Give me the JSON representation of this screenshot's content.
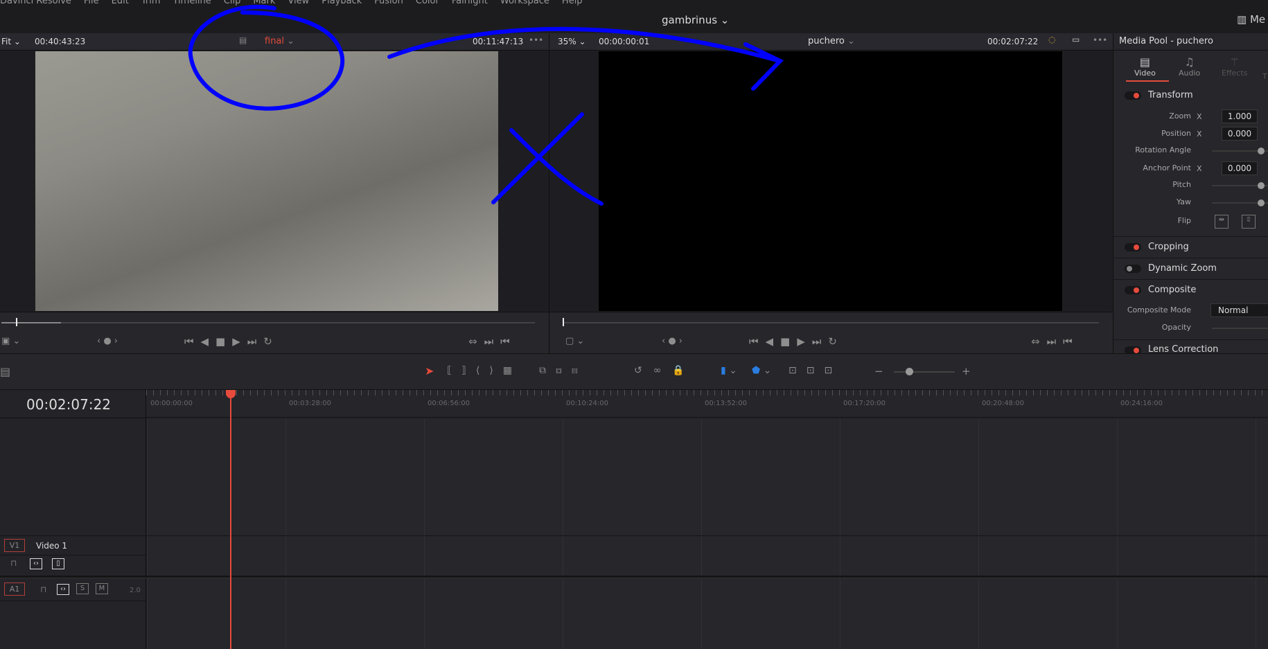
{
  "menu": [
    "Davinci Resolve",
    "File",
    "Edit",
    "Trim",
    "Timeline",
    "Clip",
    "Mark",
    "View",
    "Playback",
    "Fusion",
    "Color",
    "Fairlight",
    "Workspace",
    "Help"
  ],
  "project": "gambrinus ⌄",
  "top_right": "Me",
  "source": {
    "zoom": "Fit",
    "timecode": "00:40:43:23",
    "clip": "final",
    "duration": "00:11:47:13"
  },
  "timeline_viewer": {
    "zoom": "35%",
    "timecode": "00:00:00:01",
    "name": "puchero",
    "duration": "00:02:07:22"
  },
  "inspector": {
    "title": "Media Pool - puchero",
    "tabs": [
      "Video",
      "Audio",
      "Effects",
      "T"
    ],
    "active_tab": "Video",
    "transform": "Transform",
    "zoom_label": "Zoom",
    "zoom_x": "1.000",
    "position_label": "Position",
    "position_x": "0.000",
    "rotation_label": "Rotation Angle",
    "anchor_label": "Anchor Point",
    "anchor_x": "0.000",
    "pitch_label": "Pitch",
    "yaw_label": "Yaw",
    "flip_label": "Flip",
    "x": "X",
    "cropping": "Cropping",
    "dynamic_zoom": "Dynamic Zoom",
    "composite": "Composite",
    "composite_mode_label": "Composite Mode",
    "composite_mode": "Normal",
    "opacity_label": "Opacity",
    "lens": "Lens Correction"
  },
  "timeline": {
    "timecode": "00:02:07:22",
    "ruler": [
      "00:00:00:00",
      "00:03:28:00",
      "00:06:56:00",
      "00:10:24:00",
      "00:13:52:00",
      "00:17:20:00",
      "00:20:48:00",
      "00:24:16:00"
    ],
    "v1": {
      "badge": "V1",
      "name": "Video 1"
    },
    "a1": {
      "badge": "A1",
      "s": "S",
      "m": "M",
      "level": "2.0"
    }
  },
  "colors": {
    "accent": "#e64b3c",
    "annotation": "#0000ff",
    "flag": "#2b7de0"
  }
}
